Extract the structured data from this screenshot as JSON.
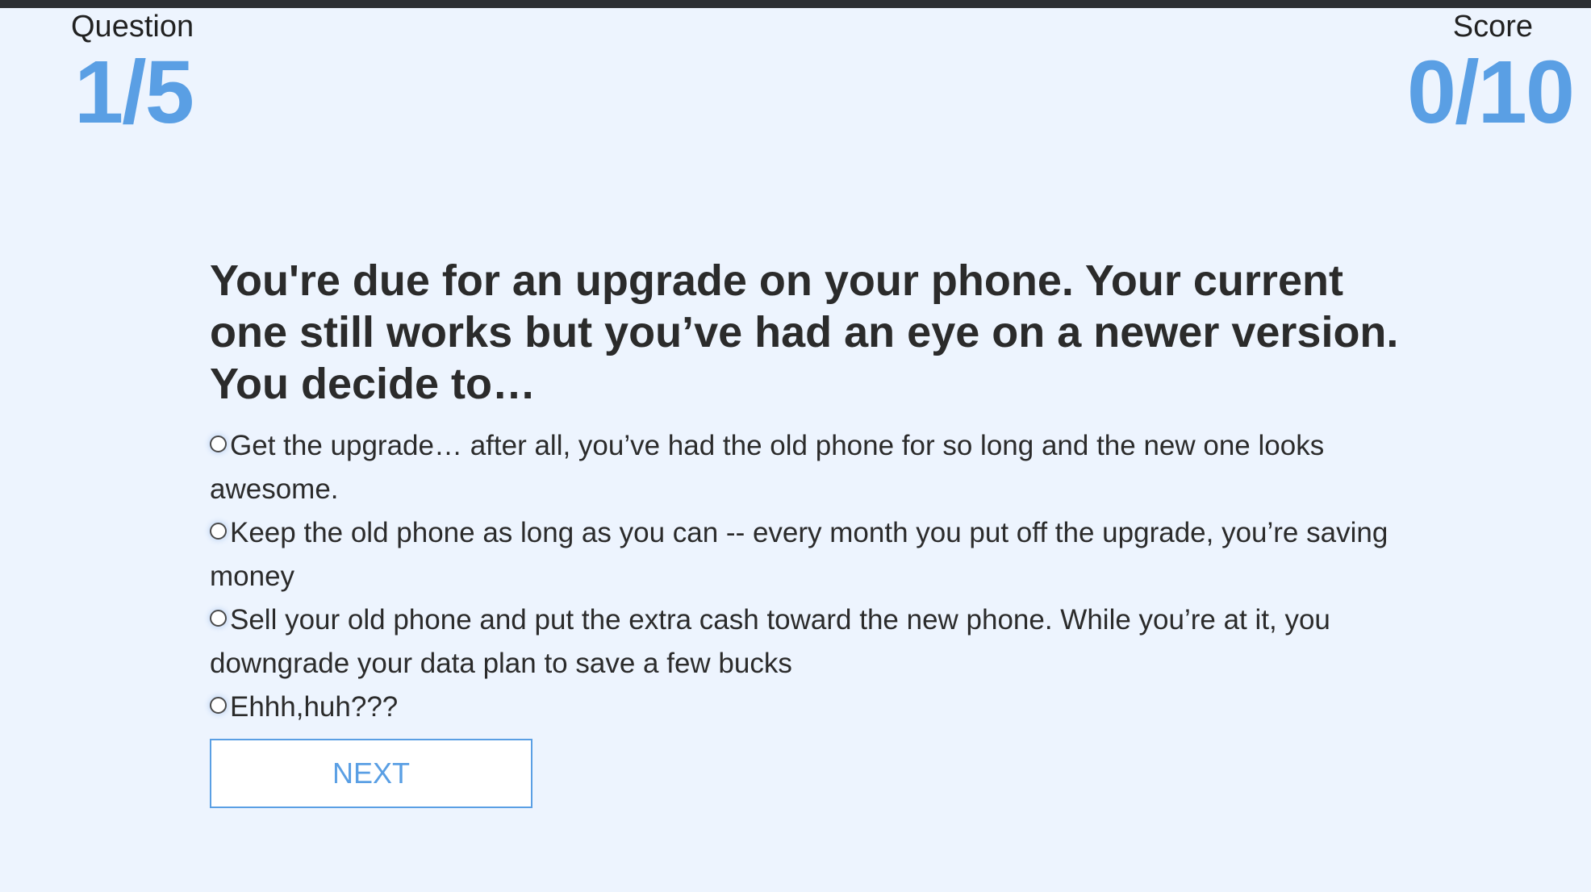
{
  "hud": {
    "question_label": "Question",
    "question_value": "1/5",
    "score_label": "Score",
    "score_value": "0/10"
  },
  "quiz": {
    "question": "You're due for an upgrade on your phone. Your current one still works but you’ve had an eye on a newer version. You decide to…",
    "choices": [
      {
        "label": "Get the upgrade… after all, you’ve had the old phone for so long and the new one looks awesome."
      },
      {
        "label": "Keep the old phone as long as you can -- every month you put off the upgrade, you’re saving money"
      },
      {
        "label": "Sell your old phone and put the extra cash toward the new phone. While you’re at it, you downgrade your data plan to save a few bucks"
      },
      {
        "label": "Ehhh,huh???"
      }
    ],
    "next_label": "NEXT"
  },
  "colors": {
    "background": "#edf4fe",
    "accent": "#5a9fe4",
    "text": "#2b2b2b"
  }
}
